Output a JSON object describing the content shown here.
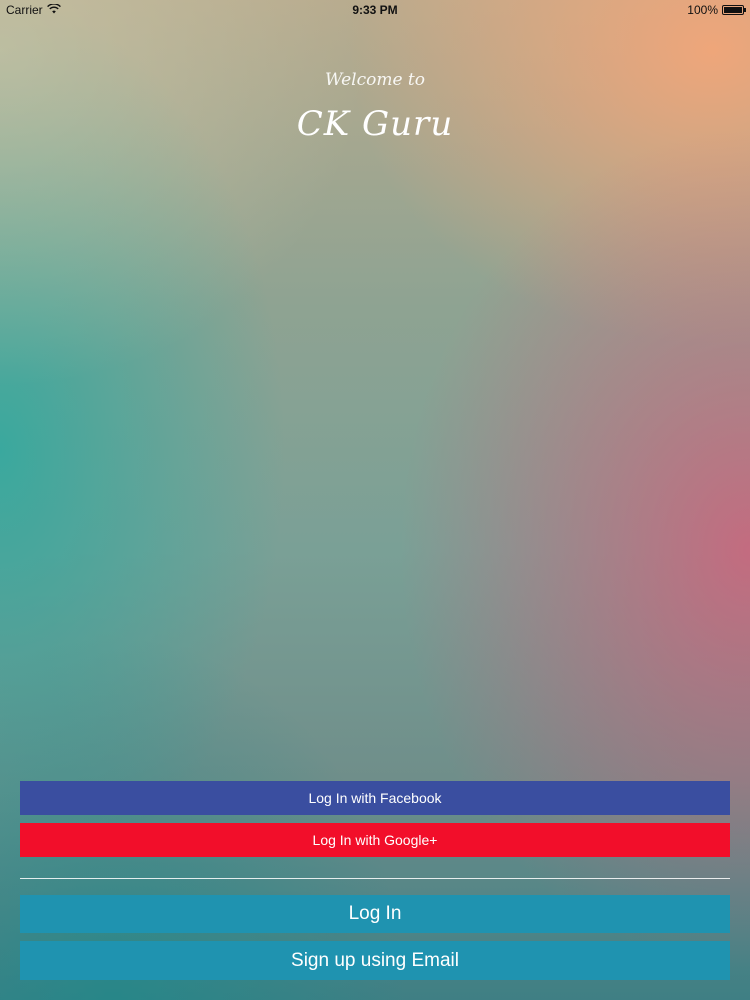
{
  "status_bar": {
    "carrier": "Carrier",
    "time": "9:33 PM",
    "battery_percent": "100%",
    "battery_level": 1.0,
    "wifi_icon": "wifi-icon",
    "battery_icon": "battery-icon"
  },
  "hero": {
    "welcome_text": "Welcome to",
    "app_name": "CK Guru"
  },
  "buttons": {
    "facebook_label": "Log In with Facebook",
    "google_label": "Log In with Google+",
    "login_label": "Log In",
    "signup_label": "Sign up using Email"
  },
  "colors": {
    "facebook": "#3a4ea0",
    "google": "#f20e2a",
    "primary": "#1f93b0"
  }
}
